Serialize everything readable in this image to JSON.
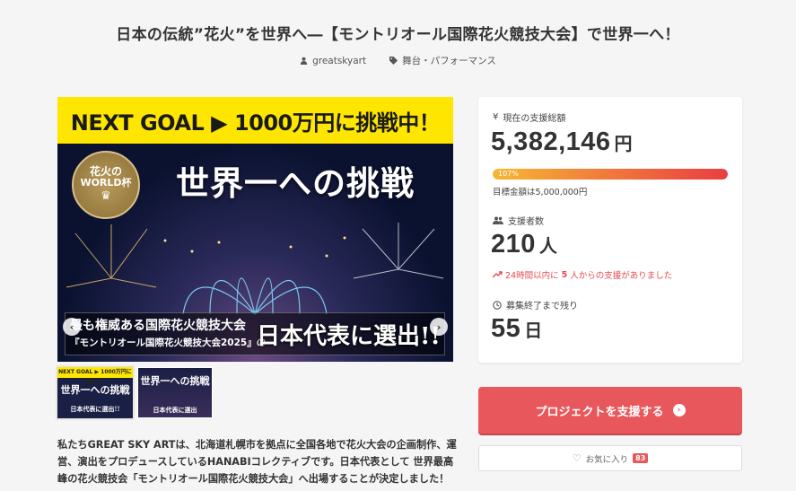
{
  "project": {
    "title": "日本の伝統”花火”を世界へ―【モントリオール国際花火競技大会】で世界一へ！",
    "owner": "greatskyart",
    "category": "舞台・パフォーマンス"
  },
  "hero": {
    "banner": "NEXT GOAL ▶ 1000万円に挑戦中！",
    "badge_line1": "花火の",
    "badge_line2": "WORLD杯",
    "headline": "世界一への挑戦",
    "caption_line1": "最も権威ある国際花火競技大会",
    "caption_line2": "『モントリオール国際花火競技大会2025』の",
    "caption_highlight": "日本代表に選出!!",
    "prev_icon": "chevron-left-icon",
    "next_icon": "chevron-right-icon"
  },
  "thumbnails": [
    {
      "top": "NEXT GOAL ▶ 1000万円に挑戦中！",
      "headline": "世界一への挑戦",
      "bottom": "日本代表に選出!!"
    },
    {
      "top": "",
      "headline": "世界一への挑戦",
      "bottom": "日本代表に選出"
    }
  ],
  "description": "私たちGREAT SKY ARTは、北海道札幌市を拠点に全国各地で花火大会の企画制作、運営、演出をプロデュースしているHANABIコレクティブです。日本代表として 世界最高峰の花火競技会「モントリオール国際花火競技大会」へ出場することが決定しました！",
  "funding": {
    "current_label": "現在の支援総額",
    "amount": "5,382,146",
    "amount_unit": "円",
    "percent": "107%",
    "progress_fraction": 1.0,
    "goal_text": "目標金額は5,000,000円",
    "backers_label": "支援者数",
    "backers": "210",
    "backers_unit": "人",
    "trend_prefix": "24時間以内に",
    "trend_count": "5",
    "trend_suffix": "人からの支援がありました",
    "remaining_label": "募集終了まで残り",
    "days": "55",
    "days_unit": "日"
  },
  "actions": {
    "support_label": "プロジェクトを支援する",
    "favorite_label": "お気に入り",
    "favorite_count": "83"
  },
  "colors": {
    "accent": "#e8575c",
    "banner_yellow": "#ffe600",
    "trend_red": "#e84a4f"
  }
}
